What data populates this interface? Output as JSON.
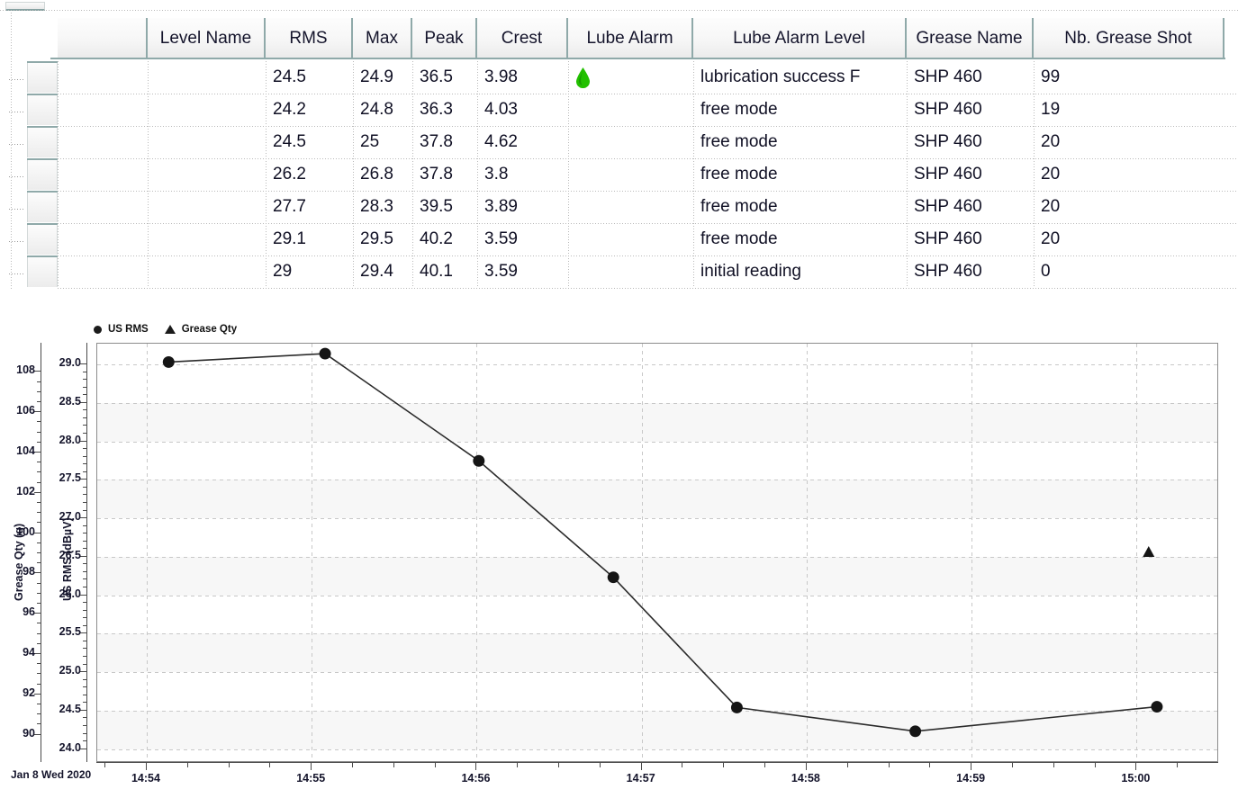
{
  "table": {
    "columns": [
      {
        "key": "gutter",
        "label": ""
      },
      {
        "key": "blank",
        "label": ""
      },
      {
        "key": "level_name",
        "label": "Level Name"
      },
      {
        "key": "rms",
        "label": "RMS"
      },
      {
        "key": "max",
        "label": "Max"
      },
      {
        "key": "peak",
        "label": "Peak"
      },
      {
        "key": "crest",
        "label": "Crest"
      },
      {
        "key": "lube_alarm",
        "label": "Lube Alarm"
      },
      {
        "key": "lube_alarm_level",
        "label": "Lube Alarm Level"
      },
      {
        "key": "grease_name",
        "label": "Grease Name"
      },
      {
        "key": "nb_grease_shot",
        "label": "Nb. Grease Shot"
      }
    ],
    "rows": [
      {
        "level_name": "",
        "rms": "24.5",
        "max": "24.9",
        "peak": "36.5",
        "crest": "3.98",
        "lube_alarm": "green-drop-icon",
        "lube_alarm_level": "lubrication success F",
        "grease_name": "SHP 460",
        "nb_grease_shot": "99"
      },
      {
        "level_name": "",
        "rms": "24.2",
        "max": "24.8",
        "peak": "36.3",
        "crest": "4.03",
        "lube_alarm": "",
        "lube_alarm_level": "free mode",
        "grease_name": "SHP 460",
        "nb_grease_shot": "19"
      },
      {
        "level_name": "",
        "rms": "24.5",
        "max": "25",
        "peak": "37.8",
        "crest": "4.62",
        "lube_alarm": "",
        "lube_alarm_level": "free mode",
        "grease_name": "SHP 460",
        "nb_grease_shot": "20"
      },
      {
        "level_name": "",
        "rms": "26.2",
        "max": "26.8",
        "peak": "37.8",
        "crest": "3.8",
        "lube_alarm": "",
        "lube_alarm_level": "free mode",
        "grease_name": "SHP 460",
        "nb_grease_shot": "20"
      },
      {
        "level_name": "",
        "rms": "27.7",
        "max": "28.3",
        "peak": "39.5",
        "crest": "3.89",
        "lube_alarm": "",
        "lube_alarm_level": "free mode",
        "grease_name": "SHP 460",
        "nb_grease_shot": "20"
      },
      {
        "level_name": "",
        "rms": "29.1",
        "max": "29.5",
        "peak": "40.2",
        "crest": "3.59",
        "lube_alarm": "",
        "lube_alarm_level": "free mode",
        "grease_name": "SHP 460",
        "nb_grease_shot": "20"
      },
      {
        "level_name": "",
        "rms": "29",
        "max": "29.4",
        "peak": "40.1",
        "crest": "3.59",
        "lube_alarm": "",
        "lube_alarm_level": "initial reading",
        "grease_name": "SHP 460",
        "nb_grease_shot": "0"
      }
    ],
    "colors": {
      "header_separator": "#8fa9a9",
      "grid_dots": "#b9b9b9",
      "alarm_drop": "#22c000"
    }
  },
  "chart_data": {
    "type": "line",
    "title": "",
    "xlabel": "",
    "date_label": "Jan 8 Wed 2020",
    "grid": true,
    "legend_position": "top-left",
    "legend": [
      "US RMS",
      "Grease Qty"
    ],
    "x_axis": {
      "tick_labels": [
        "14:54",
        "14:55",
        "14:56",
        "14:57",
        "14:58",
        "14:59",
        "15:00"
      ],
      "minor_ticks_per_interval": 4,
      "range": [
        "14:53:42",
        "15:00:30"
      ]
    },
    "y_axis_primary": {
      "label": "US RMS (dBµV)",
      "tick_labels": [
        "24.0",
        "24.5",
        "25.0",
        "25.5",
        "26.0",
        "26.5",
        "27.0",
        "27.5",
        "28.0",
        "28.5",
        "29.0"
      ],
      "ylim": [
        23.82,
        29.27
      ],
      "minor_ticks_per_interval": 5
    },
    "y_axis_secondary": {
      "label": "Grease Qty (g)",
      "tick_labels": [
        "90",
        "92",
        "94",
        "96",
        "98",
        "100",
        "102",
        "104",
        "106",
        "108"
      ],
      "ylim": [
        88.6,
        109.4
      ],
      "minor_ticks_per_interval": 4
    },
    "series": [
      {
        "name": "US RMS",
        "marker": "circle",
        "axis": "primary",
        "connected": true,
        "points": [
          {
            "x": "14:54:08",
            "y": 29.03
          },
          {
            "x": "14:55:05",
            "y": 29.14
          },
          {
            "x": "14:56:01",
            "y": 27.74
          },
          {
            "x": "14:56:50",
            "y": 26.22
          },
          {
            "x": "14:57:35",
            "y": 24.52
          },
          {
            "x": "14:58:40",
            "y": 24.21
          },
          {
            "x": "15:00:08",
            "y": 24.53
          }
        ]
      },
      {
        "name": "Grease Qty",
        "marker": "triangle",
        "axis": "secondary",
        "connected": false,
        "points": [
          {
            "x": "15:00:05",
            "y": 99
          }
        ]
      }
    ]
  }
}
